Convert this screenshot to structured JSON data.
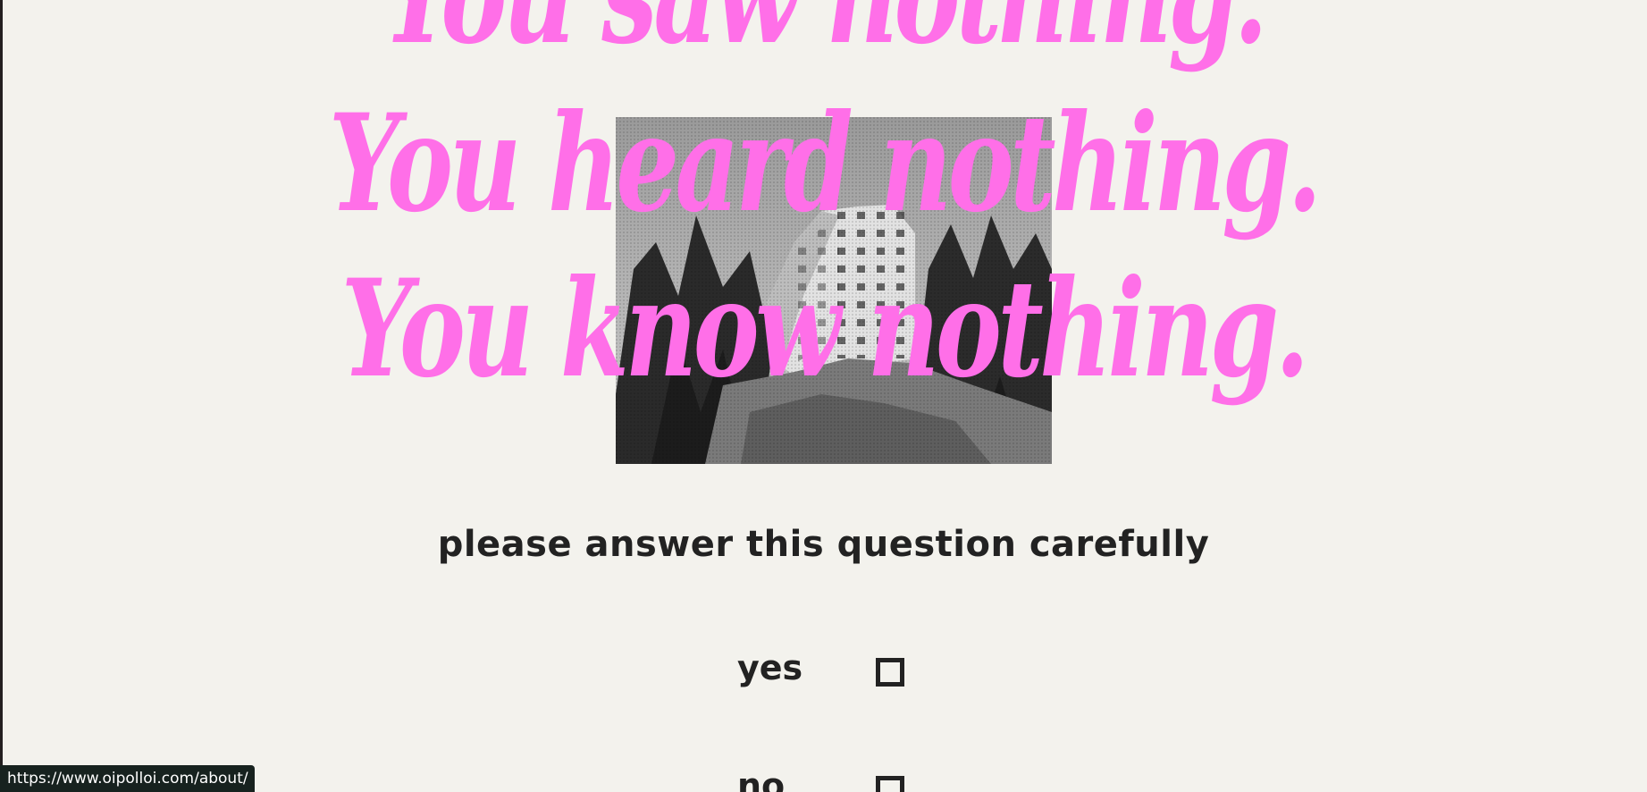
{
  "headline": {
    "line1": "You saw nothing.",
    "line2": "You heard nothing.",
    "line3": "You know nothing."
  },
  "photo": {
    "subject": "building-on-cliff-photo"
  },
  "question": {
    "text": "please answer this question carefully"
  },
  "options": [
    {
      "label": "yes",
      "checked": false
    },
    {
      "label": "no",
      "checked": false
    }
  ],
  "status_bar": {
    "url": "https://www.oipolloi.com/about/"
  },
  "colors": {
    "background": "#f3f2ed",
    "headline": "#ff6fe8",
    "text": "#222222"
  }
}
